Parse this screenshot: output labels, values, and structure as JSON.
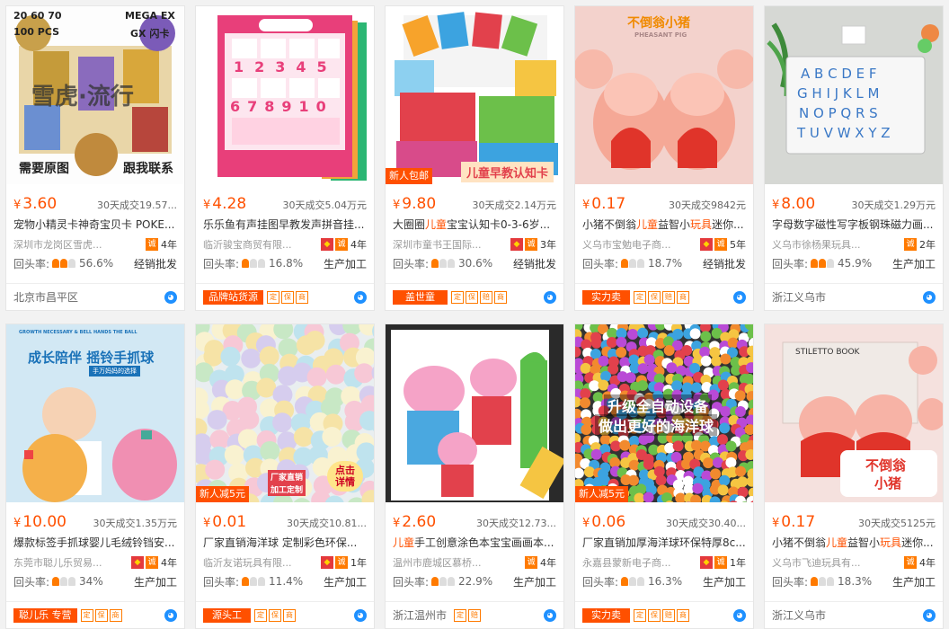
{
  "products": [
    {
      "price": "3.60",
      "sold": "30天成交19.57...",
      "title": "宠物小精灵卡神奇宝贝卡 POKE...",
      "title_hl": "",
      "shop": "深圳市龙岗区雪虎...",
      "years": "4年",
      "repeat_label": "回头率:",
      "repeat_rate": "56.6%",
      "biz": "经销批发",
      "location": "北京市昌平区",
      "tag": "",
      "badge": "",
      "img_text": [
        "20 60 70",
        "MEGA EX",
        "100 PCS",
        "GX 闪卡",
        "雪虎·流行",
        "需要原图",
        "跟我联系"
      ]
    },
    {
      "price": "4.28",
      "sold": "30天成交5.04万元",
      "title": "乐乐鱼有声挂图早教发声拼音挂...",
      "title_hl": "",
      "shop": "临沂骏宝商贸有限...",
      "years": "4年",
      "repeat_label": "回头率:",
      "repeat_rate": "16.8%",
      "biz": "生产加工",
      "location": "",
      "tag": "品牌站货源",
      "badge": "",
      "img_text": [
        "12345",
        "678910"
      ]
    },
    {
      "price": "9.80",
      "sold": "30天成交2.14万元",
      "title_pre": "大圈圈",
      "title_hl": "儿童",
      "title_post": "宝宝认知卡0-3-6岁...",
      "shop": "深圳市童书王国际...",
      "years": "3年",
      "repeat_label": "回头率:",
      "repeat_rate": "30.6%",
      "biz": "经销批发",
      "location": "",
      "tag": "盖世童",
      "badge": "新人包邮",
      "img_text": [
        "儿童早教认知卡"
      ]
    },
    {
      "price": "0.17",
      "sold": "30天成交9842元",
      "title_pre": "小猪不倒翁",
      "title_hl": "儿童",
      "title_mid": "益智小",
      "title_hl2": "玩具",
      "title_post": "迷你...",
      "shop": "义乌市宝勉电子商...",
      "years": "5年",
      "repeat_label": "回头率:",
      "repeat_rate": "18.7%",
      "biz": "经销批发",
      "location": "",
      "tag": "实力卖",
      "badge": "",
      "img_text": [
        "不倒翁小猪",
        "PHEASANT PIG"
      ]
    },
    {
      "price": "8.00",
      "sold": "30天成交1.29万元",
      "title": "字母数字磁性写字板钢珠磁力画...",
      "title_hl": "",
      "shop": "义乌市徐杨果玩具...",
      "years": "2年",
      "repeat_label": "回头率:",
      "repeat_rate": "45.9%",
      "biz": "生产加工",
      "location": "浙江义乌市",
      "tag": "",
      "badge": "",
      "img_text": [
        "A B C D E F",
        "G H I J K L M",
        "N O P Q R S",
        "T U V W X Y Z"
      ]
    },
    {
      "price": "10.00",
      "sold": "30天成交1.35万元",
      "title": "爆款标签手抓球婴儿毛绒铃铛安...",
      "title_hl": "",
      "shop": "东莞市聪儿乐贸易...",
      "years": "4年",
      "repeat_label": "回头率:",
      "repeat_rate": "34%",
      "biz": "生产加工",
      "location": "",
      "tag": "聪儿乐 专营",
      "badge": "",
      "img_text": [
        "成长陪伴  摇铃手抓球",
        "手万妈妈的选择",
        "GROWTH NECESSARY & BELL HANDS THE BALL"
      ]
    },
    {
      "price": "0.01",
      "sold": "30天成交10.81...",
      "title": "厂家直销海洋球 定制彩色环保...",
      "title_hl": "",
      "shop": "临沂友诺玩具有限...",
      "years": "1年",
      "repeat_label": "回头率:",
      "repeat_rate": "11.4%",
      "biz": "生产加工",
      "location": "",
      "tag": "源头工",
      "badge": "新人减5元",
      "img_text": [
        "厂家直销",
        "加工定制",
        "点击详情"
      ]
    },
    {
      "price": "2.60",
      "sold": "30天成交12.73...",
      "title_pre": "",
      "title_hl": "儿童",
      "title_post": "手工创意涂色本宝宝画画本...",
      "shop": "温州市鹿城区慕桥...",
      "years": "4年",
      "repeat_label": "回头率:",
      "repeat_rate": "22.9%",
      "biz": "生产加工",
      "location": "浙江温州市",
      "tag": "",
      "badge": "",
      "img_text": []
    },
    {
      "price": "0.06",
      "sold": "30天成交30.40...",
      "title": "厂家直销加厚海洋球环保特厚8c...",
      "title_hl": "",
      "shop": "永嘉县蒙新电子商...",
      "years": "1年",
      "repeat_label": "回头率:",
      "repeat_rate": "16.3%",
      "biz": "生产加工",
      "location": "",
      "tag": "实力卖",
      "badge": "新人减5元",
      "img_text": [
        "升级全自动设备",
        "做出更好的海洋球"
      ]
    },
    {
      "price": "0.17",
      "sold": "30天成交5125元",
      "title_pre": "小猪不倒翁",
      "title_hl": "儿童",
      "title_mid": "益智小",
      "title_hl2": "玩具",
      "title_post": "迷你...",
      "shop": "义乌市飞迪玩具有...",
      "years": "4年",
      "repeat_label": "回头率:",
      "repeat_rate": "18.3%",
      "biz": "生产加工",
      "location": "浙江义乌市",
      "tag": "",
      "badge": "",
      "img_text": [
        "不倒翁",
        "小猪",
        "STILETTO BOOK"
      ]
    }
  ],
  "currency": "¥",
  "colors": {
    "accent": "#ff5000",
    "badge": "#ff5000"
  }
}
